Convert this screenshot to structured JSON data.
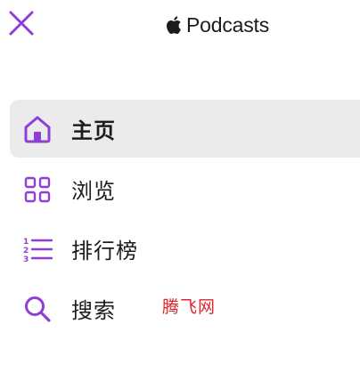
{
  "header": {
    "brand_name": "Podcasts"
  },
  "nav": {
    "items": [
      {
        "label": "主页",
        "icon": "home-icon",
        "active": true
      },
      {
        "label": "浏览",
        "icon": "browse-grid-icon",
        "active": false
      },
      {
        "label": "排行榜",
        "icon": "charts-list-icon",
        "active": false
      },
      {
        "label": "搜索",
        "icon": "search-icon",
        "active": false
      }
    ]
  },
  "watermark": {
    "text": "腾飞网"
  },
  "colors": {
    "accent": "#8e3fd6",
    "active_bg": "#ebebeb",
    "text": "#1c1c1e",
    "watermark": "#e0242b"
  }
}
